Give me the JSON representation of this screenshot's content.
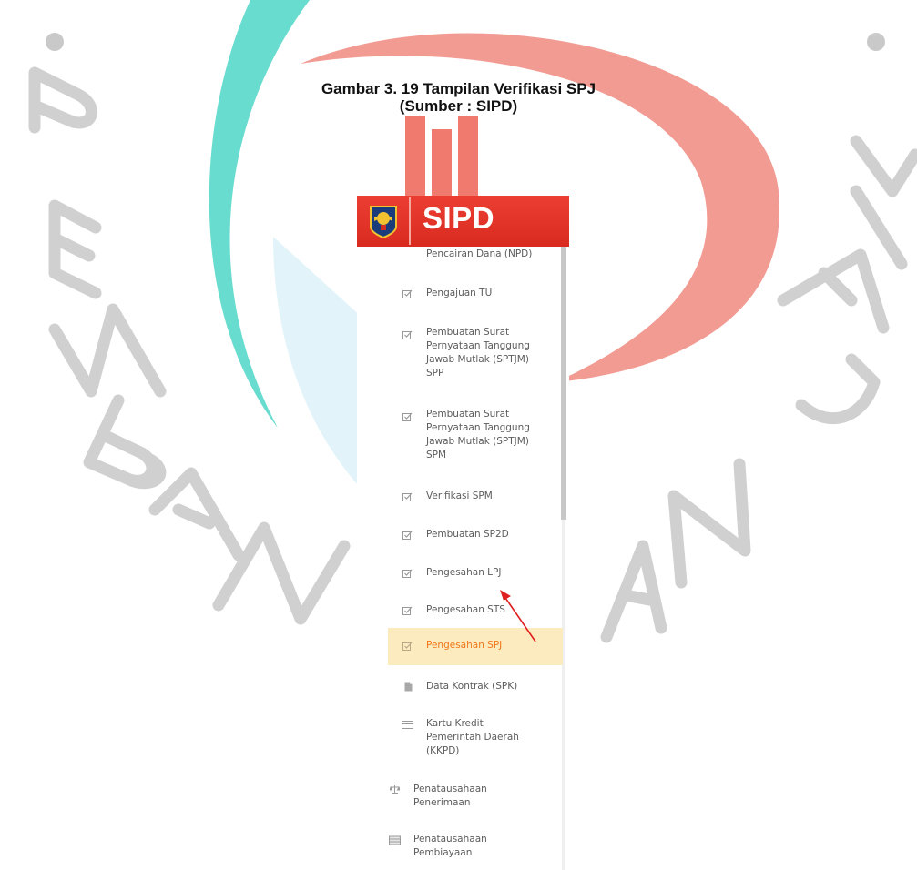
{
  "caption": {
    "line1": "Gambar 3. 19 Tampilan Verifikasi SPJ",
    "line2": "(Sumber : SIPD)"
  },
  "watermark": {
    "letters": [
      "P",
      "E",
      "M",
      "B",
      "A",
      "N",
      "G",
      "U",
      "N",
      "A",
      "N",
      "J",
      "A",
      "Y",
      "A"
    ],
    "colors": {
      "red": "#ef6b5e",
      "teal": "#3ad3c4",
      "light_blue": "#cfeef8"
    }
  },
  "app": {
    "brand": "SIPD",
    "header_color": "#e3352a",
    "active_color": "#f0761a",
    "active_bg": "#fcebbe",
    "emblem_icon": "garuda-emblem-icon"
  },
  "sidebar": {
    "partial_label": "Pencairan Dana (NPD)",
    "items": [
      {
        "label": "Pengajuan TU",
        "icon": "checkbox-edit-icon"
      },
      {
        "label": "Pembuatan Surat\nPernyataan Tanggung\nJawab Mutlak (SPTJM)\nSPP",
        "icon": "checkbox-edit-icon"
      },
      {
        "label": "Pembuatan Surat\nPernyataan Tanggung\nJawab Mutlak (SPTJM)\nSPM",
        "icon": "checkbox-edit-icon"
      },
      {
        "label": "Verifikasi SPM",
        "icon": "checkbox-edit-icon"
      },
      {
        "label": "Pembuatan SP2D",
        "icon": "checkbox-edit-icon"
      },
      {
        "label": "Pengesahan LPJ",
        "icon": "checkbox-edit-icon"
      },
      {
        "label": "Pengesahan STS",
        "icon": "checkbox-edit-icon"
      },
      {
        "label": "Pengesahan SPJ",
        "icon": "checkbox-edit-icon",
        "active": true
      },
      {
        "label": "Data Kontrak (SPK)",
        "icon": "document-icon"
      },
      {
        "label": "Kartu Kredit\nPemerintah Daerah\n(KKPD)",
        "icon": "credit-card-icon"
      },
      {
        "label": "Penatausahaan\nPenerimaan",
        "icon": "scale-icon"
      },
      {
        "label": "Penatausahaan\nPembiayaan",
        "icon": "table-icon"
      }
    ]
  },
  "annotation": {
    "type": "red-arrow",
    "points_to": "Pengesahan LPJ"
  }
}
